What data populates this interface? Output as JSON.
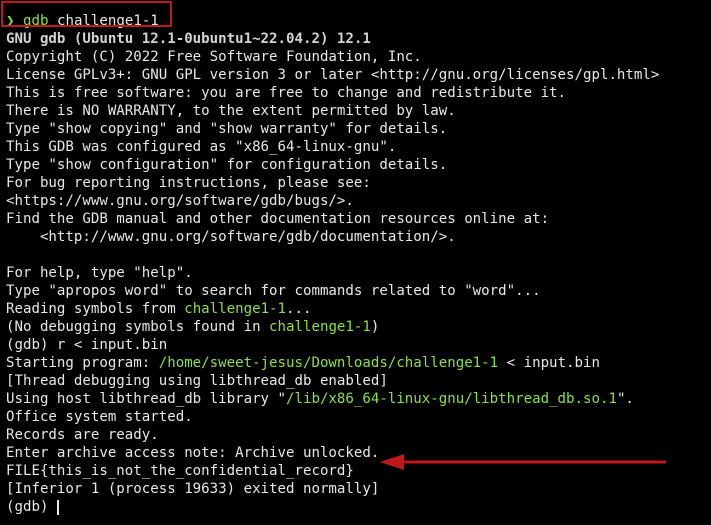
{
  "terminal": {
    "prompt_symbol": "❯",
    "command_name": "gdb",
    "command_arg": "challenge1-1",
    "version_line": "GNU gdb (Ubuntu 12.1-0ubuntu1~22.04.2) 12.1",
    "intro_lines": [
      "Copyright (C) 2022 Free Software Foundation, Inc.",
      "License GPLv3+: GNU GPL version 3 or later <http://gnu.org/licenses/gpl.html>",
      "This is free software: you are free to change and redistribute it.",
      "There is NO WARRANTY, to the extent permitted by law.",
      "Type \"show copying\" and \"show warranty\" for details.",
      "This GDB was configured as \"x86_64-linux-gnu\".",
      "Type \"show configuration\" for configuration details.",
      "For bug reporting instructions, please see:",
      "<https://www.gnu.org/software/gdb/bugs/>.",
      "Find the GDB manual and other documentation resources online at:",
      "    <http://www.gnu.org/software/gdb/documentation/>.",
      "",
      "For help, type \"help\".",
      "Type \"apropos word\" to search for commands related to \"word\"..."
    ],
    "reading_symbols_prefix": "Reading symbols from ",
    "reading_symbols_file": "challenge1-1",
    "reading_symbols_suffix": "...",
    "no_debug_prefix": "(No debugging symbols found in ",
    "no_debug_file": "challenge1-1",
    "no_debug_suffix": ")",
    "run_command": "(gdb) r < input.bin",
    "starting_prefix": "Starting program: ",
    "starting_path": "/home/sweet-jesus/Downloads/challenge1-1",
    "starting_suffix": " < input.bin",
    "thread_debug_line": "[Thread debugging using libthread_db enabled]",
    "host_lib_prefix": "Using host libthread_db library \"",
    "host_lib_path": "/lib/x86_64-linux-gnu/libthread_db.so.1",
    "host_lib_suffix": "\".",
    "output_lines": [
      "Office system started.",
      "Records are ready.",
      "Enter archive access note: Archive unlocked."
    ],
    "flag_line": "FILE{this_is_not_the_confidential_record}",
    "exit_line": "[Inferior 1 (process 19633) exited normally]",
    "final_prompt": "(gdb) "
  },
  "colors": {
    "background": "#000000",
    "text": "#e7e7e7",
    "path_green": "#8ae234",
    "annotation_red": "#c1191a"
  }
}
